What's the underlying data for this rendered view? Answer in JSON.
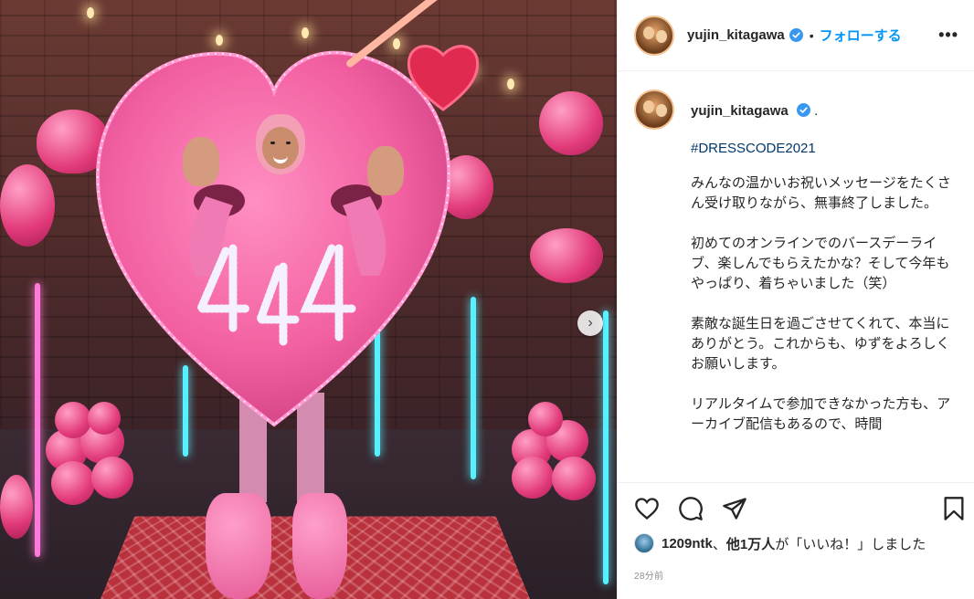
{
  "post": {
    "username": "yujin_kitagawa",
    "follow_label": "フォローする",
    "separator": "•",
    "more_label": "•••"
  },
  "comment": {
    "username": "yujin_kitagawa",
    "head_text": ".",
    "hashtag": "#DRESSCODE2021",
    "paragraphs": [
      "みんなの温かいお祝いメッセージをたくさん受け取りながら、無事終了しました。",
      "初めてのオンラインでのバースデーライブ、楽しんでもらえたかな？そして今年もやっぱり、着ちゃいました（笑）",
      "素敵な誕生日を過ごさせてくれて、本当にありがとう。これからも、ゆずをよろしくお願いします。",
      "リアルタイムで参加できなかった方も、アーカイブ配信もあるので、時間"
    ]
  },
  "likes": {
    "user": "1209ntk",
    "connector": "、",
    "others": "他1万人",
    "suffix": "が「いいね！」しました"
  },
  "timestamp": "28分前",
  "icons": {
    "verified": "verified-badge-icon",
    "like": "heart-icon",
    "comment": "comment-bubble-icon",
    "share": "paper-plane-icon",
    "save": "bookmark-icon",
    "next": "chevron-right-icon"
  },
  "colors": {
    "accent": "#0095f6",
    "hashtag": "#00376b",
    "border": "#efefef",
    "muted": "#8e8e8e"
  }
}
